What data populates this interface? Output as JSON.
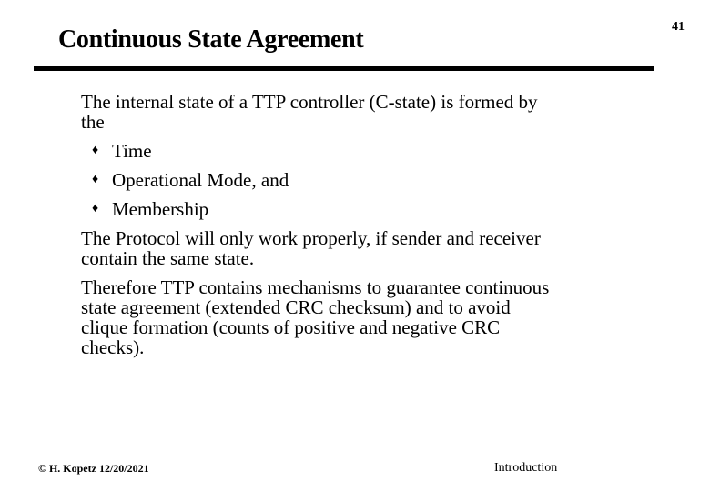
{
  "slide": {
    "page_number": "41",
    "title": "Continuous State Agreement",
    "intro_line1": "The internal state of a TTP controller (C-state) is formed by",
    "intro_line2": "the",
    "bullets": [
      {
        "icon": "diamond-bullet-icon",
        "glyph": "♦",
        "text": "Time"
      },
      {
        "icon": "diamond-bullet-icon",
        "glyph": "♦",
        "text": "Operational Mode, and"
      },
      {
        "icon": "diamond-bullet-icon",
        "glyph": "♦",
        "text": "Membership"
      }
    ],
    "para2_line1": "The Protocol will only work properly, if sender and receiver",
    "para2_line2": "contain the same state.",
    "para3_line1": "Therefore TTP contains  mechanisms to guarantee continuous",
    "para3_line2": "state agreement (extended CRC checksum) and to avoid",
    "para3_line3": "clique formation (counts of positive and negative CRC",
    "para3_line4": "checks)."
  },
  "footer": {
    "author_date": "© H. Kopetz  12/20/2021",
    "section": "Introduction"
  }
}
